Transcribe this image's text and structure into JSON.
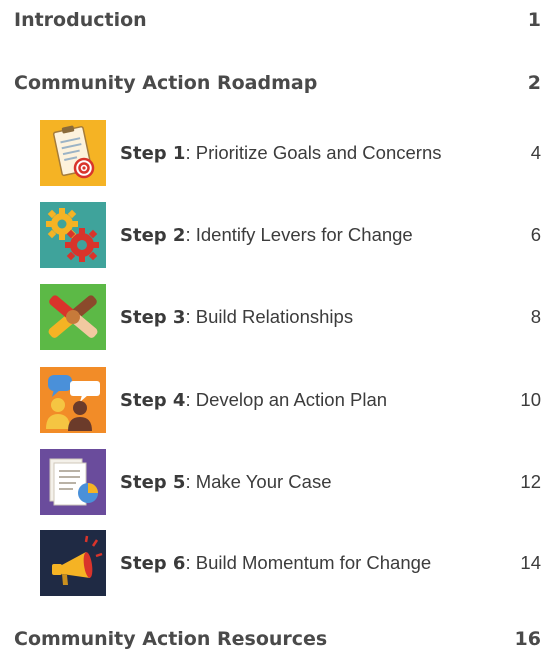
{
  "toc": {
    "introduction": {
      "title": "Introduction",
      "page": "1"
    },
    "roadmap": {
      "title": "Community Action Roadmap",
      "page": "2"
    },
    "steps": [
      {
        "label": "Step 1",
        "title": "Prioritize Goals and Concerns",
        "page": "4",
        "icon": "clipboard-target-icon",
        "color": "#f5b324"
      },
      {
        "label": "Step 2",
        "title": "Identify Levers for Change",
        "page": "6",
        "icon": "gears-icon",
        "color": "#3fa39b"
      },
      {
        "label": "Step 3",
        "title": "Build Relationships",
        "page": "8",
        "icon": "joined-hands-icon",
        "color": "#5cb946"
      },
      {
        "label": "Step 4",
        "title": "Develop an Action Plan",
        "page": "10",
        "icon": "people-speech-bubble-icon",
        "color": "#f28c28"
      },
      {
        "label": "Step 5",
        "title": "Make Your Case",
        "page": "12",
        "icon": "document-chart-icon",
        "color": "#6a4c9c"
      },
      {
        "label": "Step 6",
        "title": "Build Momentum for Change",
        "page": "14",
        "icon": "megaphone-icon",
        "color": "#1f2a44"
      }
    ],
    "resources": {
      "title": "Community Action Resources",
      "page": "16"
    }
  }
}
